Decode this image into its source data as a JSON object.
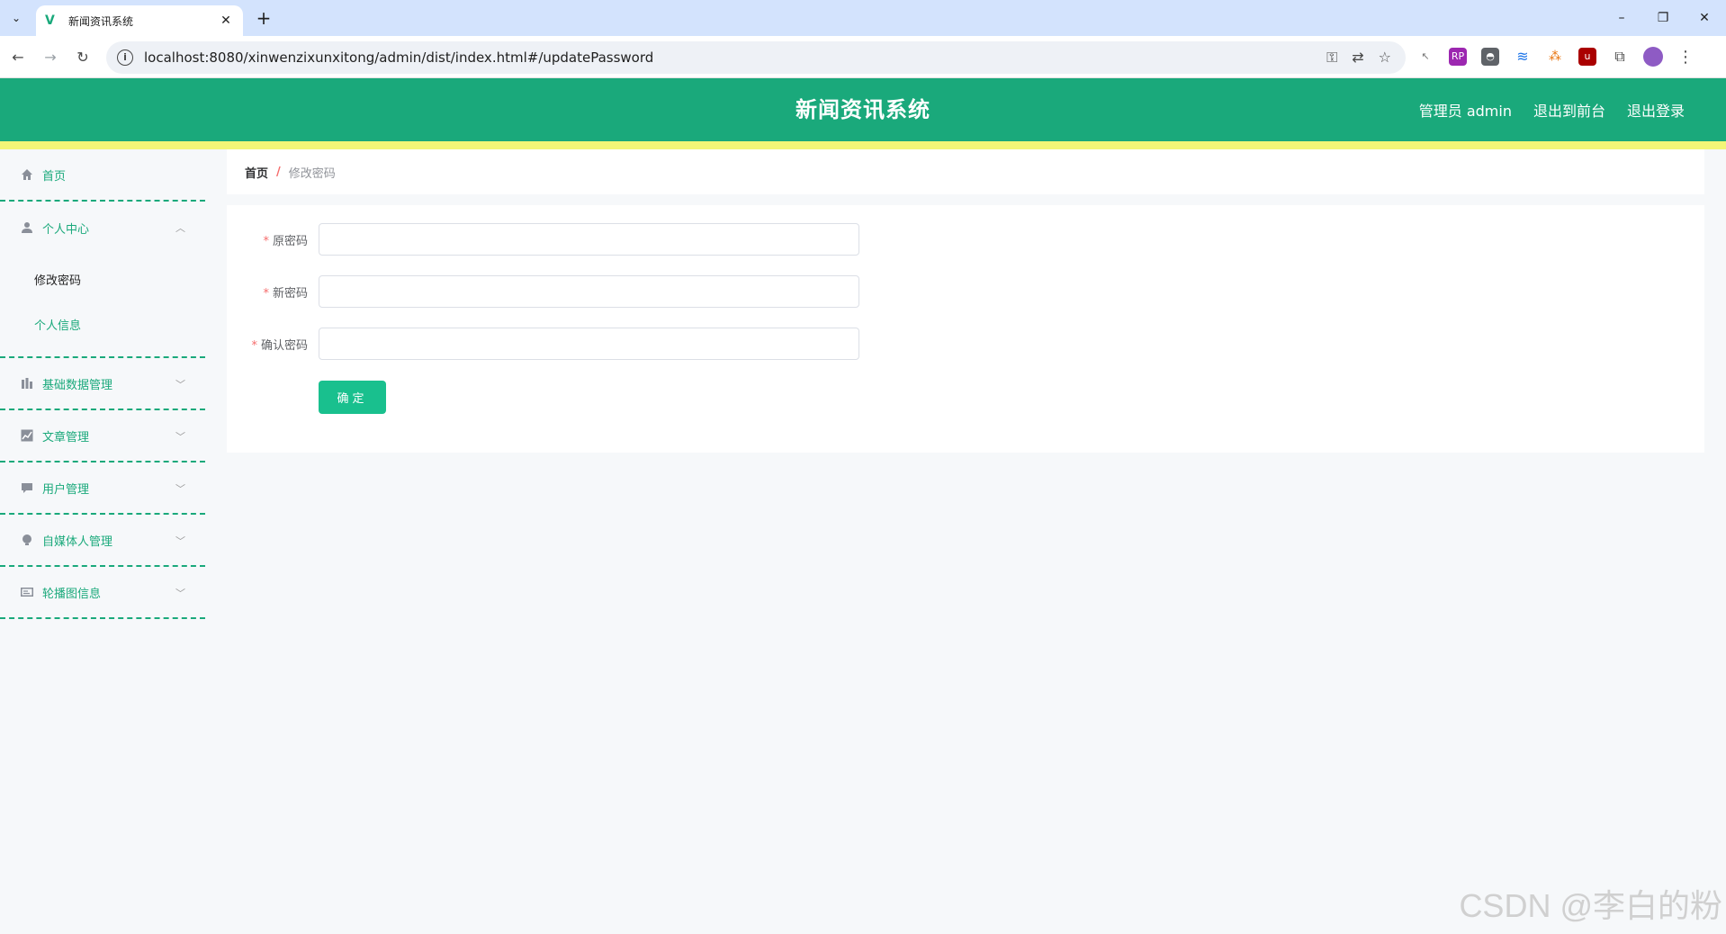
{
  "browser": {
    "tab_title": "新闻资讯系统",
    "url": "localhost:8080/xinwenzixunxitong/admin/dist/index.html#/updatePassword"
  },
  "header": {
    "title": "新闻资讯系统",
    "user": "管理员 admin",
    "to_front": "退出到前台",
    "logout": "退出登录",
    "bg_color": "#1aa97b",
    "strip_color": "#f3f677"
  },
  "sidebar": {
    "home": "首页",
    "personal_center": "个人中心",
    "change_password": "修改密码",
    "personal_info": "个人信息",
    "base_data": "基础数据管理",
    "article": "文章管理",
    "user": "用户管理",
    "self_media": "自媒体人管理",
    "carousel": "轮播图信息"
  },
  "breadcrumb": {
    "home": "首页",
    "separator": "/",
    "current": "修改密码"
  },
  "form": {
    "old_password_label": "原密码",
    "new_password_label": "新密码",
    "confirm_password_label": "确认密码",
    "required_mark": "*",
    "old_password_value": "",
    "new_password_value": "",
    "confirm_password_value": "",
    "submit_label": "确定",
    "button_color": "#19c08e"
  },
  "watermark": "CSDN @李白的粉"
}
